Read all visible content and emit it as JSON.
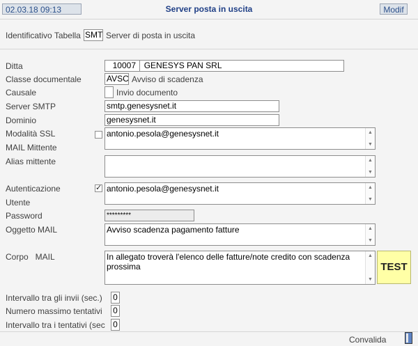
{
  "header": {
    "datetime": "02.03.18 09:13",
    "title": "Server posta in uscita",
    "mode": "Modif"
  },
  "table_id": {
    "label": "Identificativo Tabella",
    "code": "SMT",
    "description": "Server di posta in uscita"
  },
  "form": {
    "ditta_label": "Ditta",
    "ditta_code": "10007",
    "ditta_name": "GENESYS PAN SRL",
    "classe_label": "Classe documentale",
    "classe_code": "AVSC",
    "classe_desc": "Avviso di scadenza",
    "causale_label": "Causale",
    "causale_desc": "Invio documento",
    "smtp_label": "Server SMTP",
    "smtp_value": "smtp.genesysnet.it",
    "dominio_label": "Dominio",
    "dominio_value": "genesysnet.it",
    "ssl_label": "Modalità SSL",
    "ssl_checked": false,
    "mittente_label": "MAIL Mittente",
    "mittente_value": "antonio.pesola@genesysnet.it",
    "alias_label": "Alias mittente",
    "alias_value": "",
    "auth_label": "Autenticazione",
    "auth_checked": true,
    "auth_mark": "✓",
    "utente_label": "Utente",
    "utente_value": "antonio.pesola@genesysnet.it",
    "password_label": "Password",
    "password_value": "*********",
    "oggetto_label": "Oggetto MAIL",
    "oggetto_value": "Avviso scadenza pagamento fatture",
    "corpo_label": "Corpo   MAIL",
    "corpo_value": "In allegato troverà l'elenco delle fatture/note credito con scadenza prossima",
    "test_label": "TEST",
    "intervallo_invii_label": "Intervallo tra gli invii (sec.)",
    "intervallo_invii_value": "0",
    "max_tentativi_label": "Numero massimo tentativi",
    "max_tentativi_value": "0",
    "intervallo_tentativi_label": "Intervallo tra i tentativi (sec",
    "intervallo_tentativi_value": "0"
  },
  "footer": {
    "convalida_label": "Convalida"
  },
  "colors": {
    "header_title": "#1f3f86",
    "test_button_bg": "#ffffa6"
  },
  "icons": {
    "scroll_up": "up-arrow-icon",
    "scroll_down": "down-arrow-icon",
    "checkmark": "check-icon"
  }
}
